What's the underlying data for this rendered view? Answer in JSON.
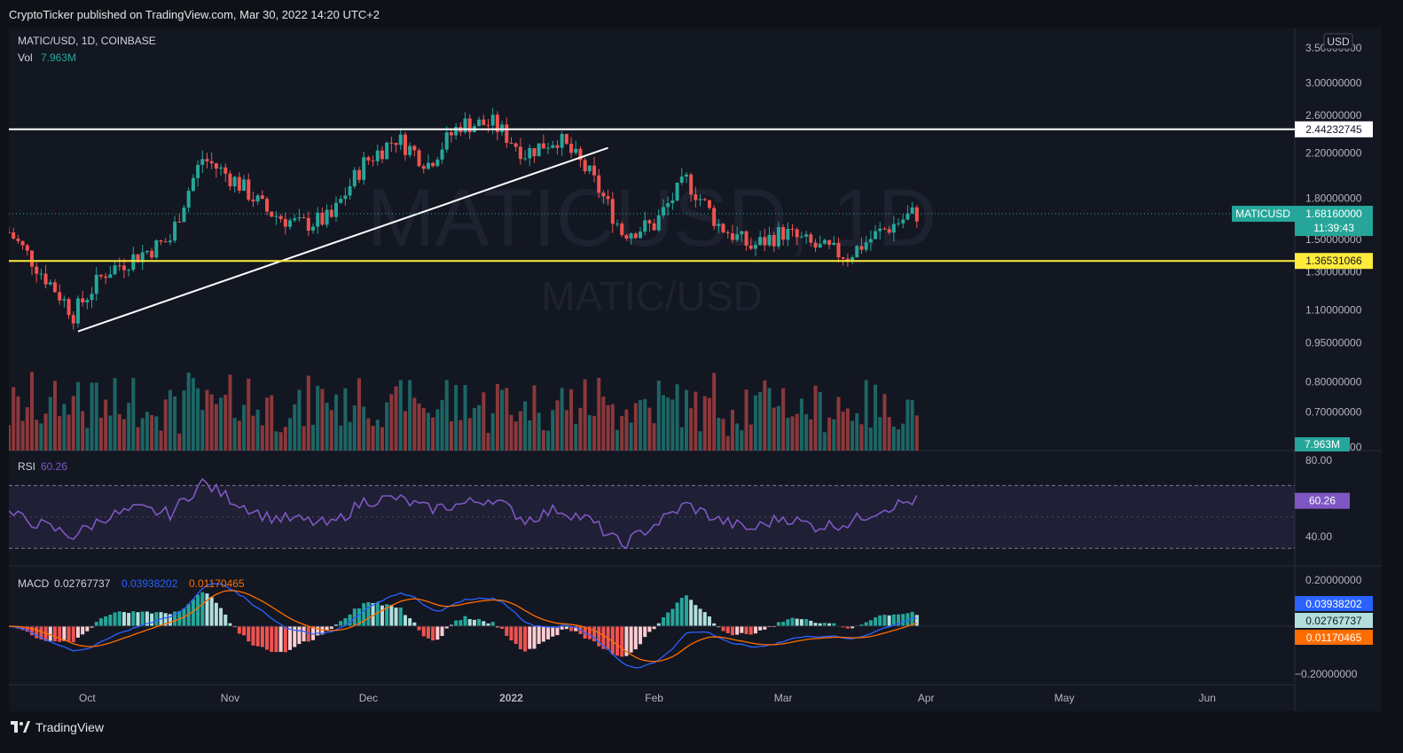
{
  "header": {
    "published": "CryptoTicker published on TradingView.com, Mar 30, 2022 14:20 UTC+2"
  },
  "legend": {
    "symbol_line": "MATIC/USD, 1D, COINBASE",
    "vol_label": "Vol",
    "vol_value": "7.963M",
    "rsi_label": "RSI",
    "rsi_value": "60.26",
    "macd_label": "MACD",
    "macd_value": "0.02767737",
    "macd_signal_value": "0.03938202",
    "macd_hist_value": "0.01170465"
  },
  "watermark": {
    "ticker": "MATICUSD, 1D",
    "pair": "MATIC/USD"
  },
  "price_axis": {
    "currency": "USD",
    "ticks": [
      "3.50000000",
      "3.00000000",
      "2.60000000",
      "2.20000000",
      "1.80000000",
      "1.50000000",
      "1.30000000",
      "1.10000000",
      "0.95000000",
      "0.80000000",
      "0.70000000",
      "0.60000000"
    ],
    "resistance_label": "2.44232745",
    "current_symbol": "MATICUSD",
    "current_price": "1.68160000",
    "countdown": "11:39:43",
    "support_label": "1.36531066",
    "volume_label": "7.963M"
  },
  "rsi_axis": {
    "ticks": [
      "80.00",
      "40.00"
    ],
    "value_label": "60.26"
  },
  "macd_axis": {
    "ticks": [
      "0.20000000",
      "−0.20000000"
    ],
    "label_macd": "0.03938202",
    "label_signal": "0.02767737",
    "label_hist": "0.01170465"
  },
  "time_axis": {
    "labels": [
      "Oct",
      "Nov",
      "Dec",
      "2022",
      "Feb",
      "Mar",
      "Apr",
      "May",
      "Jun"
    ]
  },
  "footer": {
    "brand": "TradingView"
  },
  "colors": {
    "up": "#26a69a",
    "down": "#ef5350",
    "rsi": "#7e57c2",
    "macd": "#2962ff",
    "signal": "#ff6d00",
    "support": "#ffeb3b",
    "resistance": "#ffffff",
    "background": "#131722"
  },
  "chart_data": [
    {
      "type": "candlestick",
      "title": "MATIC/USD, 1D, COINBASE",
      "scale": "log",
      "x_range": [
        "2021-09-14",
        "2022-06-20"
      ],
      "ylim": [
        0.6,
        3.5
      ],
      "resistance": 2.44232745,
      "support": 1.36531066,
      "last_close": 1.6816,
      "trendline": [
        [
          "2021-09-29",
          1.0
        ],
        [
          "2022-01-22",
          2.25
        ]
      ],
      "closes_weekly": [
        [
          "2021-09-14",
          1.55
        ],
        [
          "2021-09-21",
          1.3
        ],
        [
          "2021-09-28",
          1.08
        ],
        [
          "2021-10-05",
          1.3
        ],
        [
          "2021-10-12",
          1.4
        ],
        [
          "2021-10-19",
          1.5
        ],
        [
          "2021-10-26",
          2.15
        ],
        [
          "2021-11-02",
          1.95
        ],
        [
          "2021-11-09",
          1.7
        ],
        [
          "2021-11-16",
          1.6
        ],
        [
          "2021-11-23",
          1.65
        ],
        [
          "2021-11-30",
          2.1
        ],
        [
          "2021-12-07",
          2.35
        ],
        [
          "2021-12-14",
          2.1
        ],
        [
          "2021-12-21",
          2.5
        ],
        [
          "2021-12-28",
          2.5
        ],
        [
          "2022-01-04",
          2.2
        ],
        [
          "2022-01-11",
          2.35
        ],
        [
          "2022-01-18",
          2.0
        ],
        [
          "2022-01-25",
          1.55
        ],
        [
          "2022-02-01",
          1.6
        ],
        [
          "2022-02-08",
          1.95
        ],
        [
          "2022-02-15",
          1.6
        ],
        [
          "2022-02-22",
          1.45
        ],
        [
          "2022-03-01",
          1.55
        ],
        [
          "2022-03-08",
          1.45
        ],
        [
          "2022-03-15",
          1.4
        ],
        [
          "2022-03-22",
          1.55
        ],
        [
          "2022-03-29",
          1.68
        ]
      ]
    },
    {
      "type": "rsi",
      "value": 60.26,
      "ylim": [
        20,
        90
      ],
      "bands": [
        30,
        70
      ],
      "values_weekly": [
        52,
        45,
        38,
        50,
        55,
        52,
        72,
        60,
        50,
        48,
        45,
        60,
        62,
        55,
        58,
        62,
        48,
        55,
        48,
        32,
        45,
        58,
        48,
        42,
        50,
        44,
        46,
        55,
        60.26
      ]
    },
    {
      "type": "macd",
      "macd": 0.03938202,
      "signal": 0.02767737,
      "histogram": 0.01170465,
      "ylim": [
        -0.27,
        0.27
      ]
    }
  ]
}
